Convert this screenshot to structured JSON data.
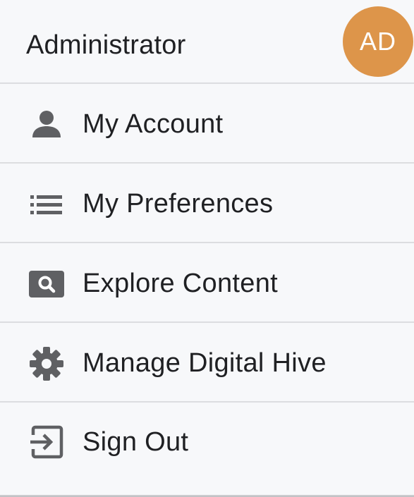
{
  "header": {
    "user_name": "Administrator",
    "avatar_initials": "AD",
    "avatar_color": "#dd954a"
  },
  "menu": {
    "items": [
      {
        "label": "My Account",
        "icon": "person-icon"
      },
      {
        "label": "My Preferences",
        "icon": "list-icon"
      },
      {
        "label": "Explore Content",
        "icon": "search-box-icon"
      },
      {
        "label": "Manage Digital Hive",
        "icon": "gear-icon"
      },
      {
        "label": "Sign Out",
        "icon": "sign-out-icon"
      }
    ]
  },
  "colors": {
    "background": "#f7f8fa",
    "divider": "#dcdde0",
    "icon": "#5f6063",
    "text": "#1f2023"
  }
}
